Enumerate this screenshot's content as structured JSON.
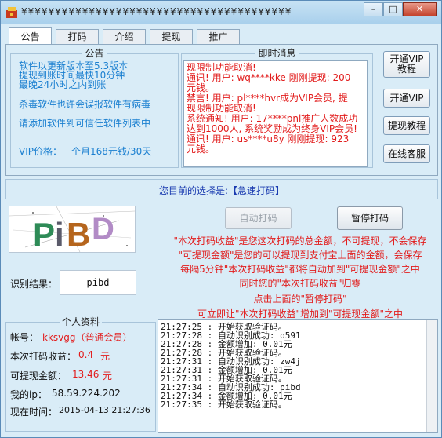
{
  "window": {
    "title": "¥¥¥¥¥¥¥¥¥¥¥¥¥¥¥¥¥¥¥¥¥¥¥¥¥¥¥¥¥¥¥¥¥¥¥¥¥¥¥¥",
    "minimize": "–",
    "maximize": "□",
    "close": "✕"
  },
  "tabs": [
    "公告",
    "打码",
    "介绍",
    "提现",
    "推广"
  ],
  "notice": {
    "title": "公告",
    "lines": [
      "软件以更新版本至5.3版本",
      "提现到账时间最快10分钟",
      "最晚24小时之内到账",
      "杀毒软件也许会误报软件有病毒",
      "请添加软件到可信任软件列表中",
      "VIP价格：一个月168元钱/30天"
    ]
  },
  "news": {
    "title": "即时消息",
    "lines": [
      "现限制功能取消!",
      "通讯!  用户: wq****kke 刚刚提现: 200",
      "元钱。",
      "禁言!  用户: pl****hvr成为VIP会员, 提",
      "现限制功能取消!",
      "系统通知!  用户: 17****pnl推广人数成功",
      "达到1000人, 系统奖励成为终身VIP会员!",
      "通讯!  用户: us****u8y 刚刚提现: 923",
      "元钱。"
    ]
  },
  "side_buttons": {
    "vip_tutorial_line1": "开通VIP",
    "vip_tutorial_line2": "教程",
    "open_vip": "开通VIP",
    "withdraw_tutorial": "提现教程",
    "online_service": "在线客服"
  },
  "choice": {
    "text": "您目前的选择是:【急速打码】"
  },
  "captcha": {
    "text": "PiBD"
  },
  "buttons": {
    "auto": "自动打码",
    "pause": "暂停打码"
  },
  "info_lines": [
    "\"本次打码收益\"是您这次打码的总金额，不可提现，不会保存",
    "\"可提现金额\"是您的可以提现到支付宝上面的金额，会保存",
    "每隔5分钟\"本次打码收益\"都将自动加到\"可提现金额\"之中",
    "同时您的\"本次打码收益\"归零",
    "点击上面的\"暂停打码\"",
    "可立即让\"本次打码收益\"增加到\"可提现金额\"之中"
  ],
  "recognition": {
    "label": "识别结果：",
    "value": "pibd"
  },
  "profile": {
    "title": "个人资料",
    "account_label": "帐号：",
    "account_value": "kksvgg（普通会员）",
    "earn_label": "本次打码收益：",
    "earn_value": "0.4",
    "earn_unit": "元",
    "withdraw_label": "可提现金额：",
    "withdraw_value": "13.46",
    "withdraw_unit": "元",
    "ip_label": "我的ip：",
    "ip_value": "58.59.224.202",
    "time_label": "现在时间：",
    "time_value": "2015-04-13 21:27:36"
  },
  "log": [
    "21:27:25 : 开始获取验证码。",
    "21:27:28 : 自动识别成功: o591",
    "21:27:28 : 金额增加: 0.01元",
    "21:27:28 : 开始获取验证码。",
    "21:27:31 : 自动识别成功: zw4j",
    "21:27:31 : 金额增加: 0.01元",
    "21:27:31 : 开始获取验证码。",
    "21:27:34 : 自动识别成功: pibd",
    "21:27:34 : 金额增加: 0.01元",
    "21:27:35 : 开始获取验证码。"
  ],
  "colors": {
    "notice_text": "#1a7fd0",
    "alert_red": "#e21b1b",
    "choice_blue": "#1a3bb0",
    "window_bg": "#d9ecf7"
  }
}
